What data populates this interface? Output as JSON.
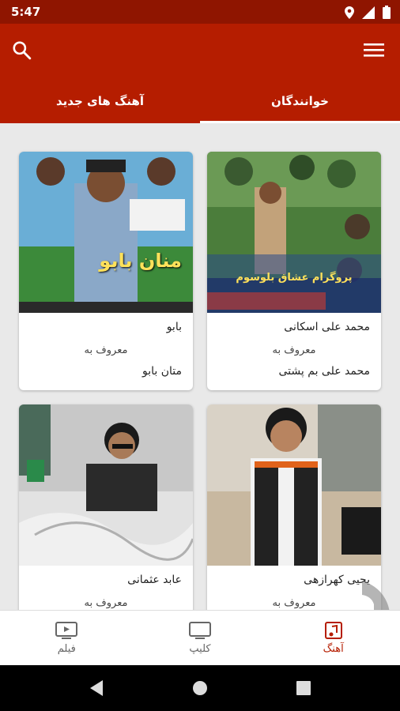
{
  "status": {
    "time": "5:47"
  },
  "app_bar": {
    "icons": [
      "search-icon",
      "menu-icon"
    ],
    "tabs": [
      {
        "label": "خوانندگان",
        "active": true
      },
      {
        "label": "آهنگ های جدید",
        "active": false
      }
    ]
  },
  "cards": [
    {
      "name": "محمد علی اسکانی",
      "known": "معروف به",
      "fullname": "محمد علی بم پشتی",
      "overlay": "پروگرام عشاق بلوسوم"
    },
    {
      "name": "بابو",
      "known": "معروف به",
      "fullname": "متان بابو",
      "overlay": "منان بابو"
    },
    {
      "name": "یحیی کهرازهی",
      "known": "معروف به",
      "fullname": ""
    },
    {
      "name": "عابد عثمانی",
      "known": "معروف به",
      "fullname": ""
    }
  ],
  "bottom_nav": [
    {
      "label": "آهنگ",
      "icon": "music-icon",
      "active": true
    },
    {
      "label": "کلیپ",
      "icon": "tv-icon",
      "active": false
    },
    {
      "label": "فیلم",
      "icon": "video-icon",
      "active": false
    }
  ],
  "colors": {
    "primary": "#b51d00",
    "status": "#8f1500"
  }
}
